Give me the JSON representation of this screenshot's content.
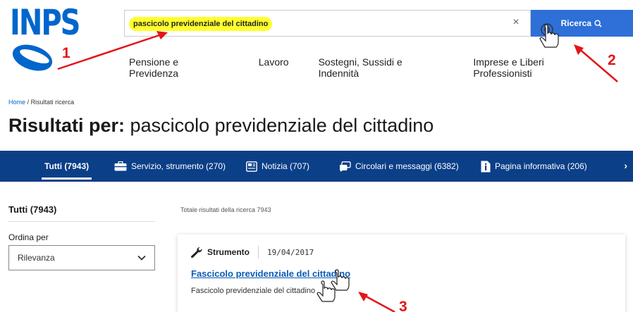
{
  "header": {
    "logo_text": "INPS",
    "search": {
      "value": "pascicolo previdenziale del cittadino",
      "clear_label": "×",
      "button_label": "Ricerca"
    },
    "nav": [
      "Pensione e Previdenza",
      "Lavoro",
      "Sostegni, Sussidi e Indennità",
      "Imprese e Liberi Professionisti"
    ]
  },
  "breadcrumb": {
    "home": "Home",
    "separator": "/",
    "current": "Risultati ricerca"
  },
  "title": {
    "prefix": "Risultati per:",
    "query": "pascicolo previdenziale del cittadino"
  },
  "tabs": [
    {
      "label": "Tutti (7943)",
      "icon": "",
      "active": true
    },
    {
      "label": "Servizio, strumento (270)",
      "icon": "briefcase-icon"
    },
    {
      "label": "Notizia (707)",
      "icon": "newspaper-icon"
    },
    {
      "label": "Circolari e messaggi (6382)",
      "icon": "chat-icon"
    },
    {
      "label": "Pagina informativa (206)",
      "icon": "info-icon"
    }
  ],
  "filters": {
    "title": "Tutti (7943)",
    "sort_label": "Ordina per",
    "sort_value": "Rilevanza"
  },
  "results": {
    "total_text": "Totale risultati della ricerca 7943",
    "items": [
      {
        "type": "Strumento",
        "date": "19/04/2017",
        "title": "Fascicolo previdenziale del cittadino",
        "description": "Fascicolo previdenziale del cittadino"
      }
    ]
  },
  "annotations": [
    "1",
    "2",
    "3"
  ],
  "colors": {
    "brand_blue": "#0066cc",
    "tabbar": "#0b3f87",
    "search_button": "#2e6fd8",
    "highlight": "#ffff2e",
    "annotation_red": "#e3151a"
  }
}
